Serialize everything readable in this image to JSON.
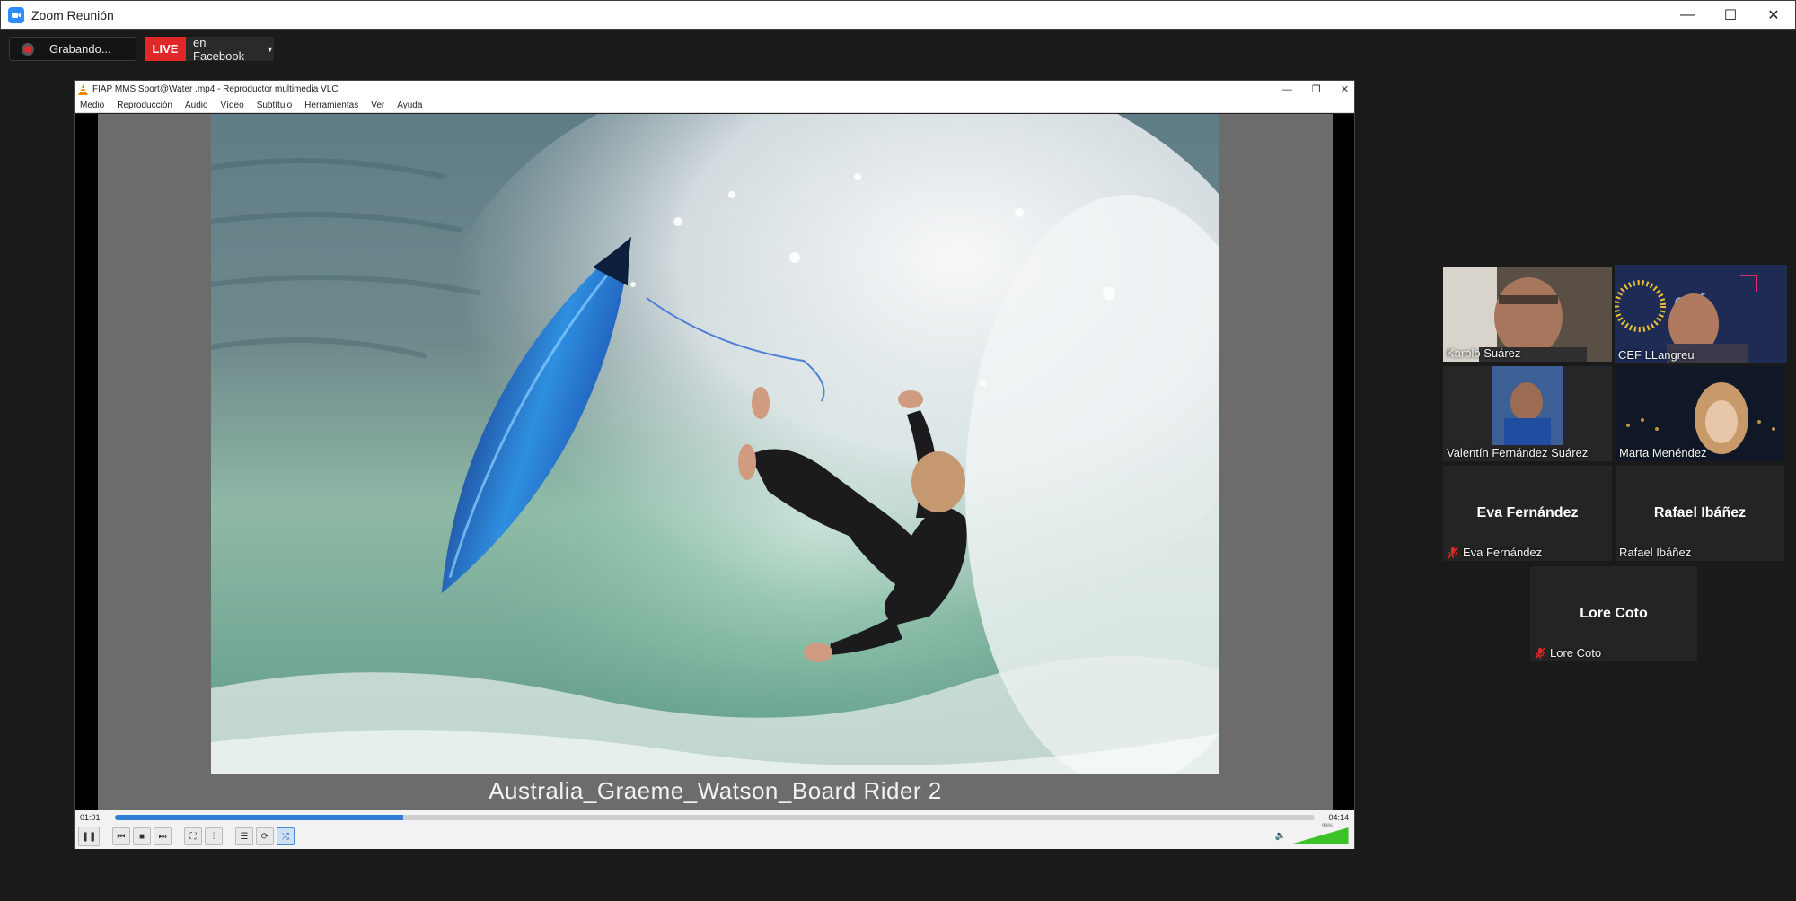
{
  "zoom": {
    "window_title": "Zoom Reunión",
    "win_controls": {
      "minimize": "—",
      "maximize": "☐",
      "close": "✕"
    },
    "recording_label": "Grabando...",
    "live_label": "LIVE",
    "live_target": "en Facebook"
  },
  "vlc": {
    "title": "FIAP MMS Sport@Water .mp4 - Reproductor multimedia VLC",
    "menu": [
      "Medio",
      "Reproducción",
      "Audio",
      "Vídeo",
      "Subtítulo",
      "Herramientas",
      "Ver",
      "Ayuda"
    ],
    "caption": "Australia_Graeme_Watson_Board Rider 2",
    "time_current": "01:01",
    "time_total": "04:14",
    "progress_fraction": 0.24,
    "volume_percent": "99%",
    "volume_fraction": 0.99
  },
  "participants": [
    {
      "name": "Karolo Suárez",
      "video": true,
      "muted": false
    },
    {
      "name": "CEF LLangreu",
      "video": true,
      "muted": false,
      "speaking": true
    },
    {
      "name": "Valentín Fernández Suárez",
      "video": true,
      "muted": false
    },
    {
      "name": "Marta Menéndez",
      "video": true,
      "muted": false
    },
    {
      "name": "Eva Fernández",
      "video": false,
      "muted": true
    },
    {
      "name": "Rafael Ibáñez",
      "video": false,
      "muted": false
    },
    {
      "name": "Lore Coto",
      "video": false,
      "muted": true
    }
  ],
  "colors": {
    "live_red": "#e02828",
    "speaker_outline": "#d6ef58",
    "vlc_progress": "#2f7fd6",
    "volume_green": "#3ec22a"
  }
}
